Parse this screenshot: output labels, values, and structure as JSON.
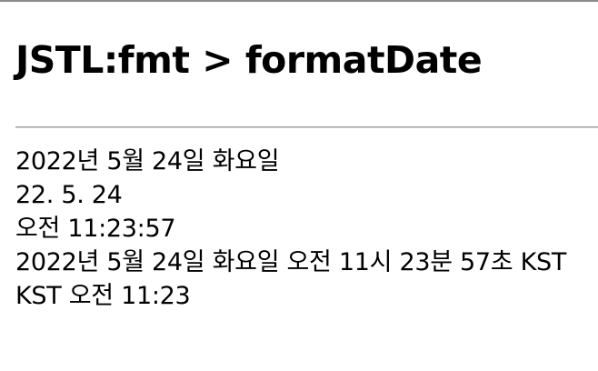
{
  "page": {
    "title": "JSTL:fmt > formatDate"
  },
  "output": {
    "lines": [
      "2022년 5월 24일 화요일",
      "22. 5. 24",
      "오전 11:23:57",
      "2022년 5월 24일 화요일 오전 11시 23분 57초 KST",
      "KST 오전 11:23"
    ]
  }
}
